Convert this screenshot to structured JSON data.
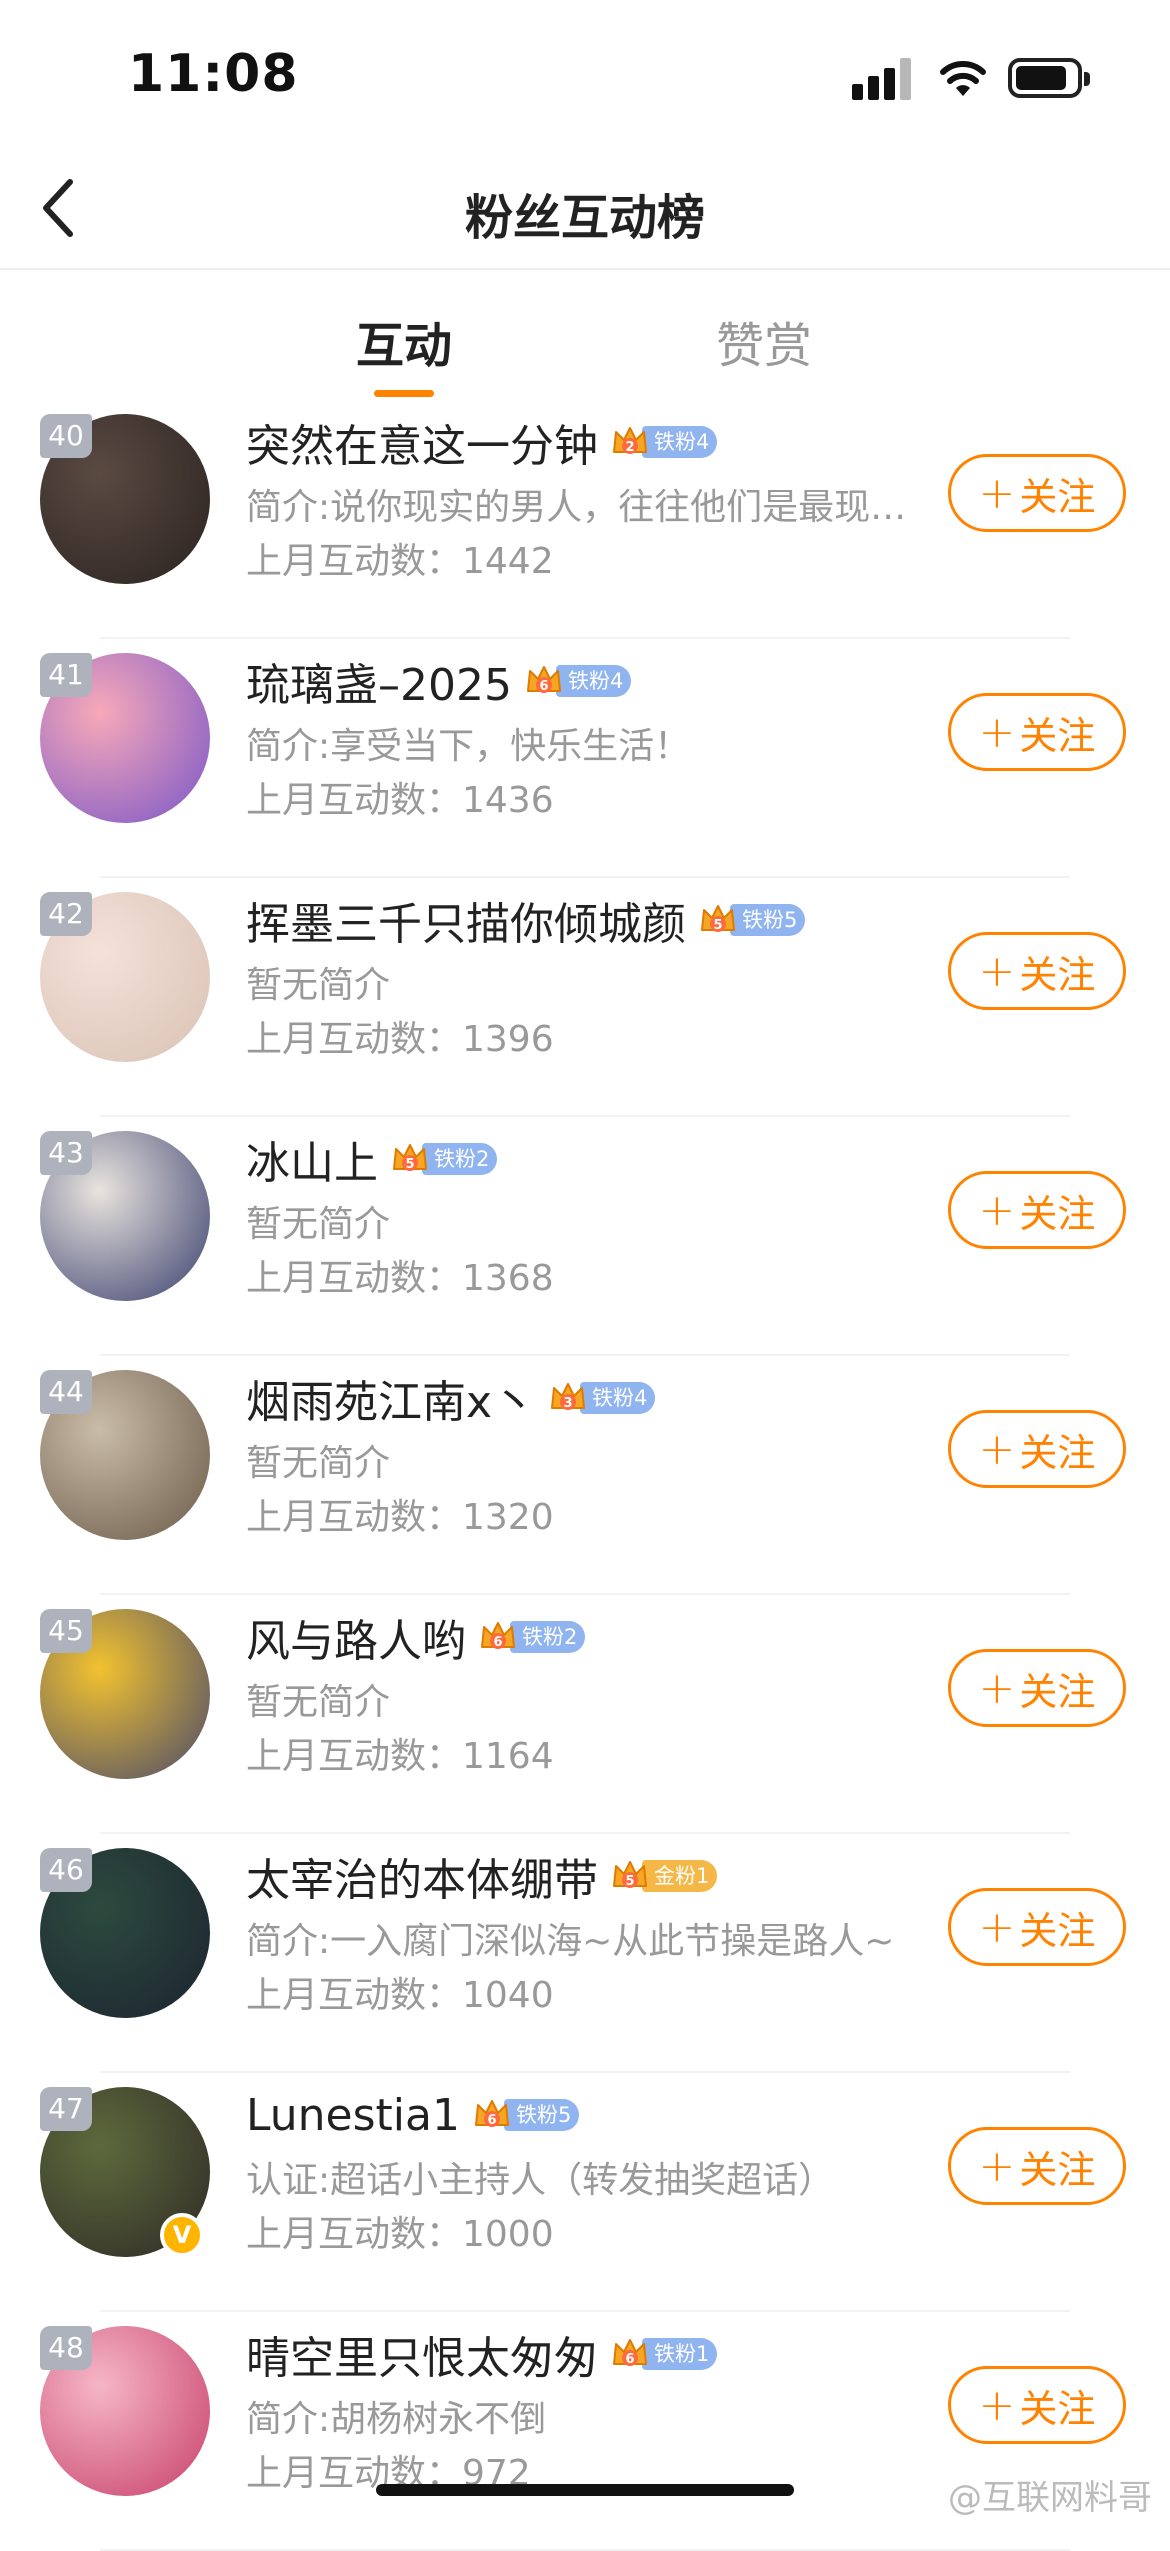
{
  "status_bar": {
    "time": "11:08"
  },
  "header": {
    "title": "粉丝互动榜",
    "back_icon": "chevron-left-icon"
  },
  "tabs": [
    {
      "label": "互动",
      "active": true
    },
    {
      "label": "赞赏",
      "active": false
    }
  ],
  "accent_color": "#ff8200",
  "fans": [
    {
      "rank": "40",
      "name": "突然在意这一分钟",
      "badge_level": "2",
      "badge_label": "铁粉4",
      "badge_type": "iron",
      "bio": "简介:说你现实的男人，往往他们是最现…",
      "count": "上月互动数：1442",
      "follow": "关注",
      "verified": false
    },
    {
      "rank": "41",
      "name": "琉璃盏–2025",
      "badge_level": "6",
      "badge_label": "铁粉4",
      "badge_type": "iron",
      "bio": "简介:享受当下，快乐生活！",
      "count": "上月互动数：1436",
      "follow": "关注",
      "verified": false
    },
    {
      "rank": "42",
      "name": "挥墨三千只描你倾城颜",
      "badge_level": "5",
      "badge_label": "铁粉5",
      "badge_type": "iron",
      "bio": "暂无简介",
      "count": "上月互动数：1396",
      "follow": "关注",
      "verified": false
    },
    {
      "rank": "43",
      "name": "冰山上",
      "badge_level": "5",
      "badge_label": "铁粉2",
      "badge_type": "iron",
      "bio": "暂无简介",
      "count": "上月互动数：1368",
      "follow": "关注",
      "verified": false
    },
    {
      "rank": "44",
      "name": "烟雨苑江南x丶",
      "badge_level": "3",
      "badge_label": "铁粉4",
      "badge_type": "iron",
      "bio": "暂无简介",
      "count": "上月互动数：1320",
      "follow": "关注",
      "verified": false
    },
    {
      "rank": "45",
      "name": "风与路人哟",
      "badge_level": "6",
      "badge_label": "铁粉2",
      "badge_type": "iron",
      "bio": "暂无简介",
      "count": "上月互动数：1164",
      "follow": "关注",
      "verified": false
    },
    {
      "rank": "46",
      "name": "太宰治的本体绷带",
      "badge_level": "5",
      "badge_label": "金粉1",
      "badge_type": "gold",
      "bio": "简介:一入腐门深似海~从此节操是路人~",
      "count": "上月互动数：1040",
      "follow": "关注",
      "verified": false
    },
    {
      "rank": "47",
      "name": "Lunestia1",
      "badge_level": "6",
      "badge_label": "铁粉5",
      "badge_type": "iron",
      "bio": "认证:超话小主持人（转发抽奖超话）",
      "count": "上月互动数：1000",
      "follow": "关注",
      "verified": true,
      "verified_mark": "V"
    },
    {
      "rank": "48",
      "name": "晴空里只恨太匆匆",
      "badge_level": "6",
      "badge_label": "铁粉1",
      "badge_type": "iron",
      "bio": "简介:胡杨树永不倒",
      "count": "上月互动数：972",
      "follow": "关注",
      "verified": false
    }
  ],
  "avatar_colors": [
    [
      "#5a4a42",
      "#2a2220"
    ],
    [
      "#f7a9b8",
      "#7a56c8"
    ],
    [
      "#f4e1d8",
      "#d9c2b5"
    ],
    [
      "#e8e4de",
      "#3a3f6e"
    ],
    [
      "#c9bca8",
      "#6b5a48"
    ],
    [
      "#f2c230",
      "#4a4a6a"
    ],
    [
      "#2d4a3e",
      "#1b2430"
    ],
    [
      "#5d6a3c",
      "#2f2a26"
    ],
    [
      "#f6b6c8",
      "#c7406a"
    ]
  ],
  "watermark": "@互联网料哥"
}
